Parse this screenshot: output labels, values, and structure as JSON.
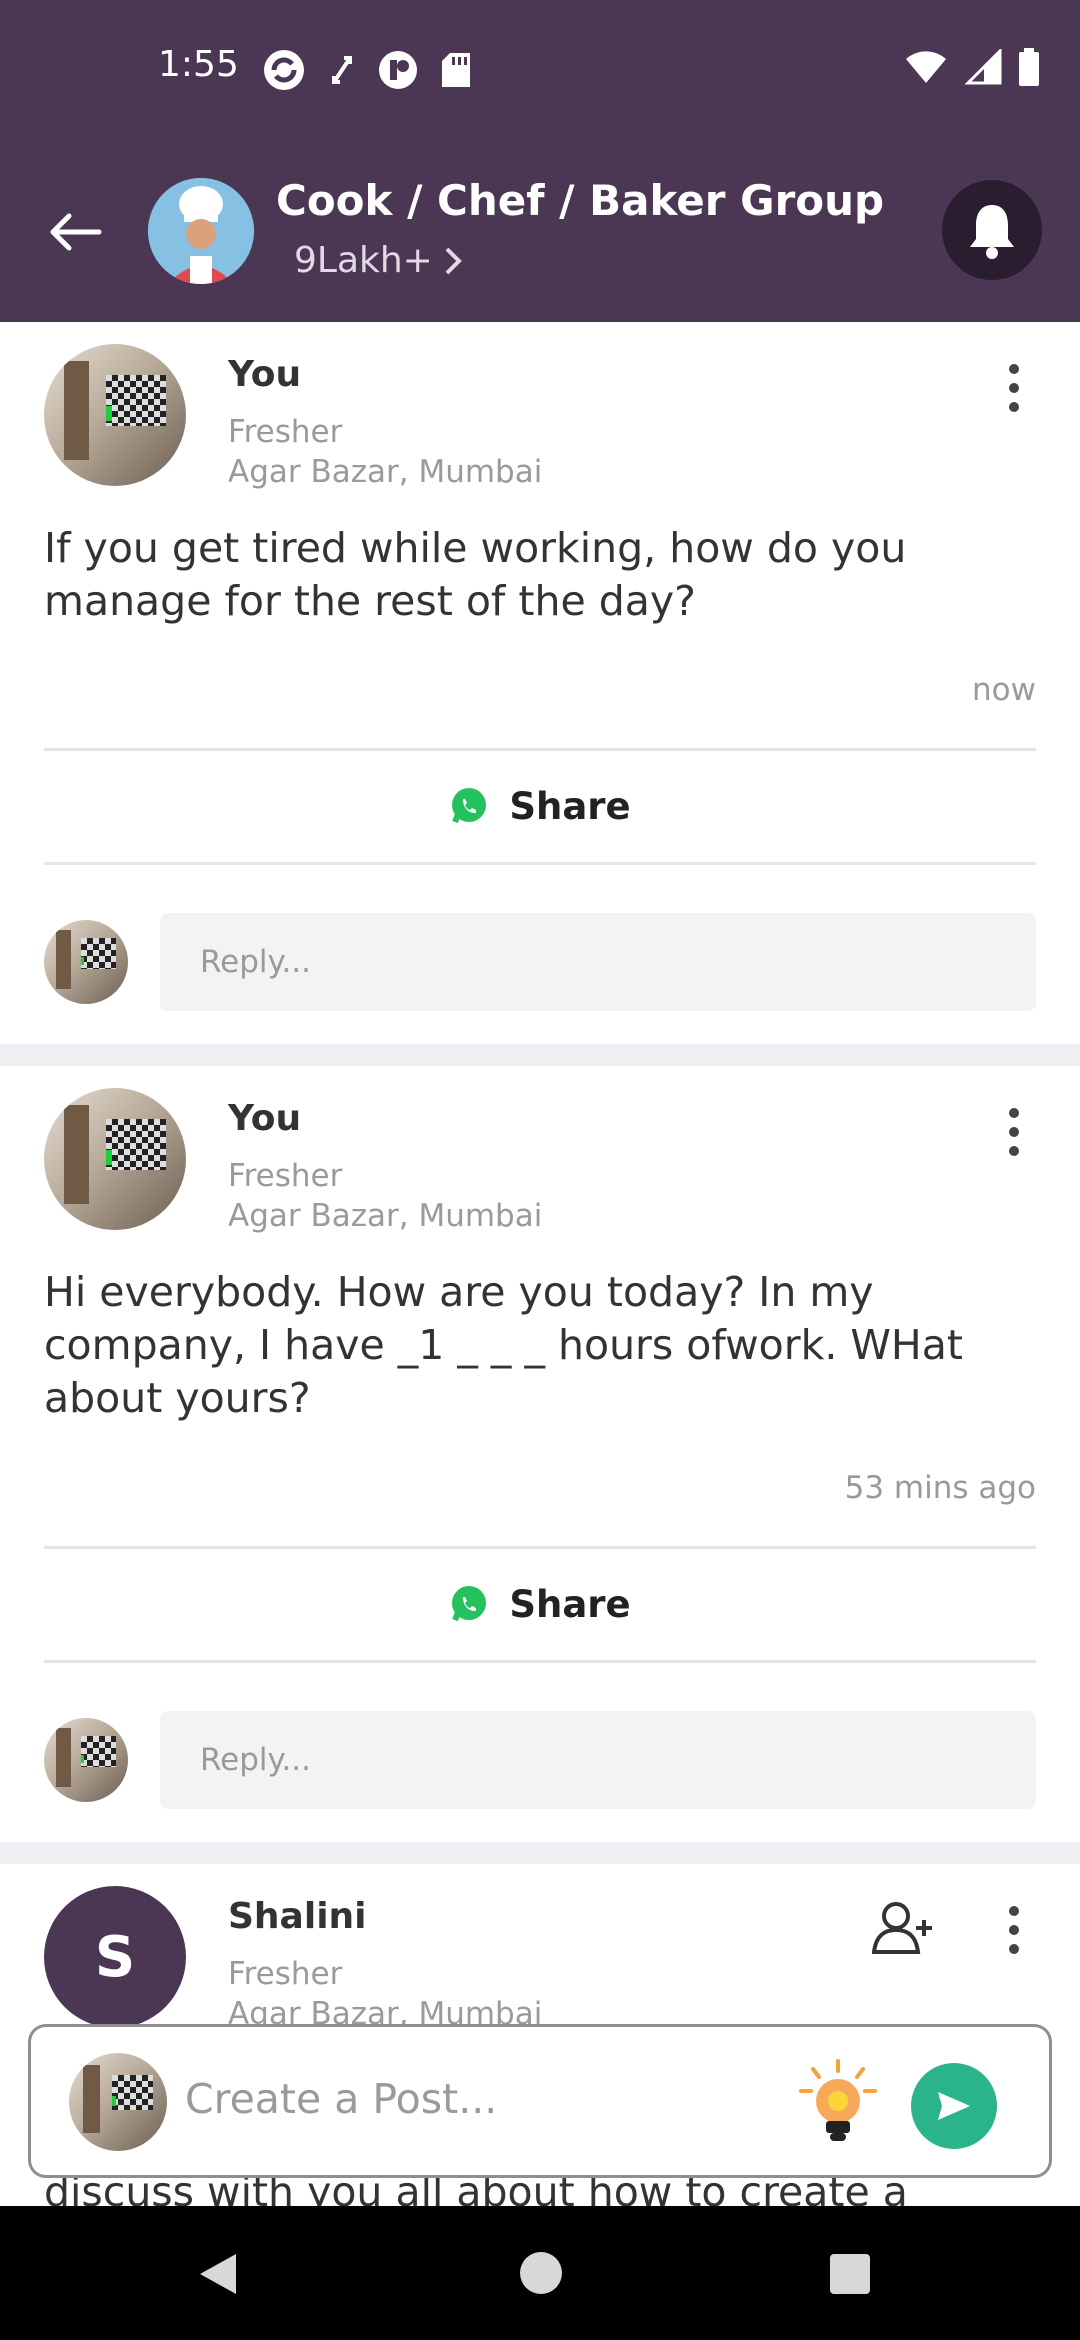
{
  "status_bar": {
    "time": "1:55"
  },
  "header": {
    "title": "Cook / Chef / Baker Group",
    "members": "9Lakh+"
  },
  "posts": [
    {
      "author": "You",
      "level": "Fresher",
      "location": "Agar Bazar, Mumbai",
      "body": "If you get tired while working, how do you manage for the rest of the day?",
      "time": "now",
      "share_label": "Share",
      "reply_placeholder": "Reply..."
    },
    {
      "author": "You",
      "level": "Fresher",
      "location": "Agar Bazar, Mumbai",
      "body": "Hi everybody. How are you today? In my company, I have _1 _ _ _ hours ofwork. WHat about yours?",
      "time": "53 mins ago",
      "share_label": "Share",
      "reply_placeholder": "Reply..."
    },
    {
      "author": "Shalini",
      "avatar_letter": "S",
      "level": "Fresher",
      "location": "Agar Bazar, Mumbai",
      "body_peek": "discuss with you all about how to create a"
    }
  ],
  "composer": {
    "placeholder": "Create a Post..."
  },
  "colors": {
    "header_bg": "#4b3653",
    "send_green": "#2bb48c",
    "whatsapp_green": "#25c15c"
  }
}
